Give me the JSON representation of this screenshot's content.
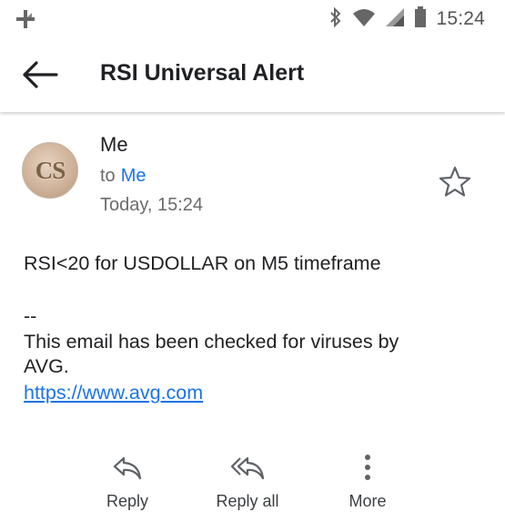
{
  "status_bar": {
    "time": "15:24",
    "icons": [
      "pinwheel-icon",
      "bluetooth-icon",
      "wifi-icon",
      "signal-icon",
      "battery-icon"
    ]
  },
  "app_bar": {
    "title": "RSI Universal Alert",
    "back_icon": "arrow-left-icon"
  },
  "message": {
    "avatar_initials": "CS",
    "sender": "Me",
    "to_prefix": "to",
    "recipient": "Me",
    "date": "Today, 15:24",
    "body": {
      "line1": "RSI<20 for USDOLLAR on M5 timeframe",
      "signature_separator": "--",
      "signature_line1": "This email has been checked for viruses by",
      "signature_line2": "AVG.",
      "link": "https://www.avg.com"
    }
  },
  "actions": {
    "reply": "Reply",
    "reply_all": "Reply all",
    "more": "More"
  },
  "colors": {
    "link": "#1a73e8",
    "secondary_text": "#6b6b6b",
    "icon_gray": "#5f6368"
  }
}
